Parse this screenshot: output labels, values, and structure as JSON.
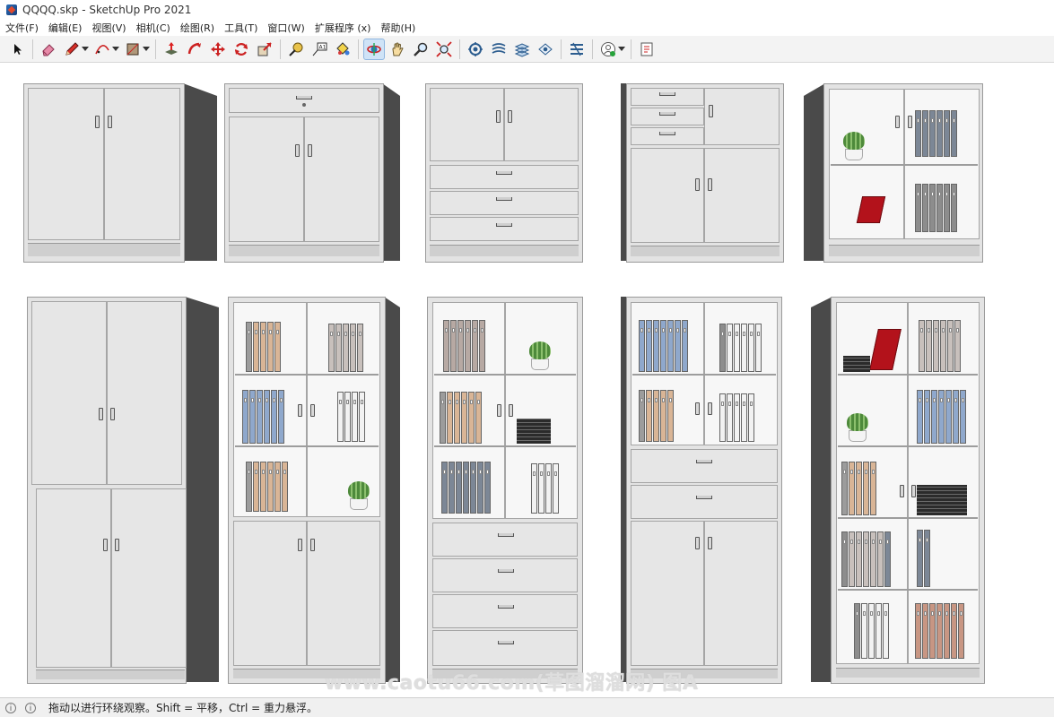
{
  "window": {
    "title": "QQQQ.skp - SketchUp Pro 2021"
  },
  "menu": {
    "items": [
      "文件(F)",
      "编辑(E)",
      "视图(V)",
      "相机(C)",
      "绘图(R)",
      "工具(T)",
      "窗口(W)",
      "扩展程序 (x)",
      "帮助(H)"
    ]
  },
  "toolbar": {
    "tools": [
      "select-icon",
      "eraser-icon",
      "pencil-icon",
      "arc-icon",
      "rectangle-icon",
      "push-pull-icon",
      "follow-me-icon",
      "move-icon",
      "rotate-icon",
      "scale-icon",
      "tape-measure-icon",
      "text-label-icon",
      "paint-bucket-icon",
      "orbit-icon",
      "pan-icon",
      "zoom-icon",
      "zoom-extents-icon",
      "sandbox-icon",
      "section-plane-icon",
      "components-icon",
      "styles-icon",
      "account-icon",
      "extension-warehouse-icon"
    ],
    "active_tool": "orbit-icon"
  },
  "watermark": "www.caotu66.com(草图溜溜网) 图A",
  "status": {
    "message": "拖动以进行环绕观察。Shift = 平移，Ctrl = 重力悬浮。"
  },
  "colors": {
    "binder_beige": "#d9b596",
    "binder_blue": "#8fa8cc",
    "binder_gray": "#c8c0bc",
    "binder_slate": "#7c8796",
    "binder_salmon": "#c89683",
    "red_box": "#b3121b",
    "cabinet_side": "#4a4a4a"
  }
}
